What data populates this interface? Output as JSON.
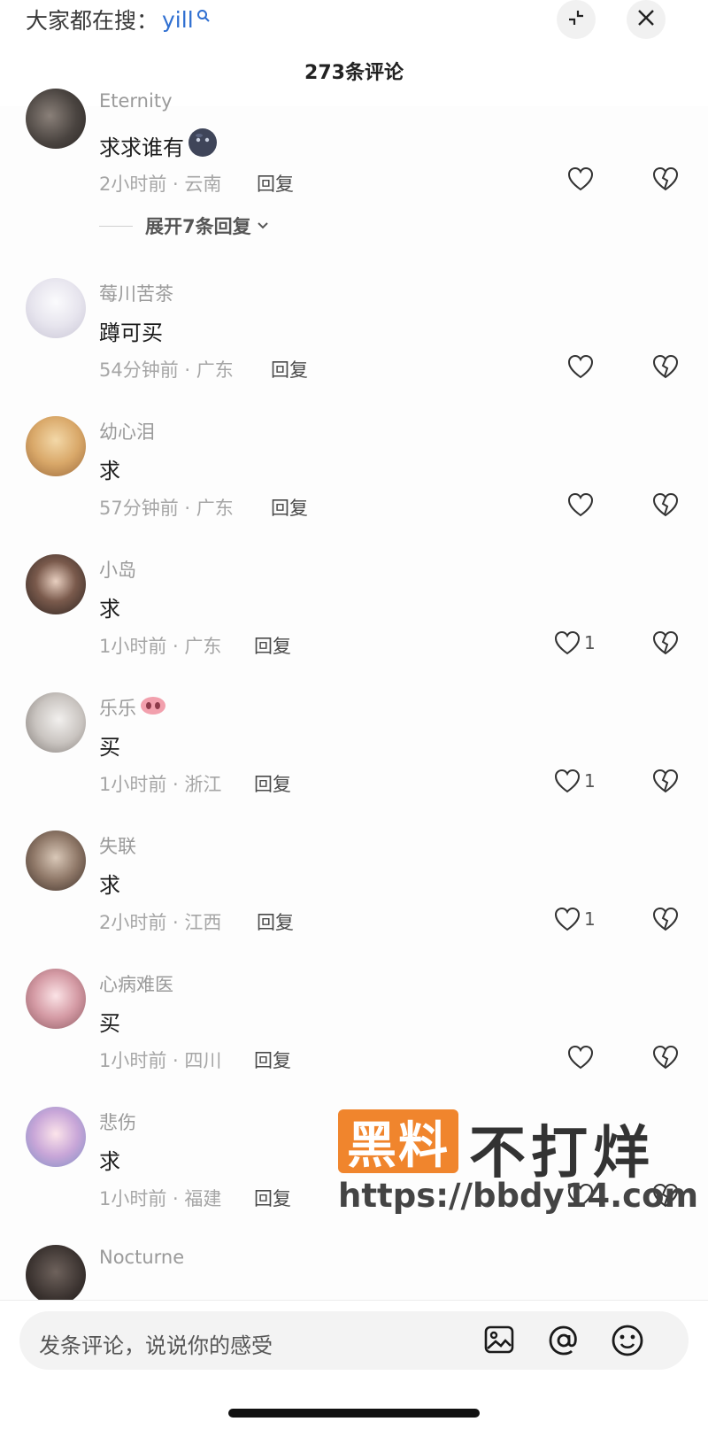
{
  "header": {
    "search_prefix": "大家都在搜：",
    "search_keyword": "yill",
    "comment_count": "273条评论"
  },
  "comments": [
    {
      "user": "Eternity",
      "text": "求求谁有",
      "emoji": "blob",
      "time_location": "2小时前 · 云南",
      "reply": "回复",
      "likes": "",
      "expand": "展开7条回复"
    },
    {
      "user": "莓川苦茶",
      "text": "蹲可买",
      "time_location": "54分钟前 · 广东",
      "reply": "回复",
      "likes": ""
    },
    {
      "user": "幼心泪",
      "text": "求",
      "time_location": "57分钟前 · 广东",
      "reply": "回复",
      "likes": ""
    },
    {
      "user": "小岛",
      "text": "求",
      "time_location": "1小时前 · 广东",
      "reply": "回复",
      "likes": "1"
    },
    {
      "user": "乐乐",
      "user_emoji": "pig-nose",
      "text": "买",
      "time_location": "1小时前 · 浙江",
      "reply": "回复",
      "likes": "1"
    },
    {
      "user": "失联",
      "text": "求",
      "time_location": "2小时前 · 江西",
      "reply": "回复",
      "likes": "1"
    },
    {
      "user": "心病难医",
      "text": "买",
      "time_location": "1小时前 · 四川",
      "reply": "回复",
      "likes": ""
    },
    {
      "user": "悲伤",
      "text": "求",
      "time_location": "1小时前 · 福建",
      "reply": "回复",
      "likes": ""
    },
    {
      "user": "Nocturne"
    }
  ],
  "watermark": {
    "box": "黑料",
    "title": "不打烊",
    "url": "https://bbdy14.com"
  },
  "bottom": {
    "placeholder": "发条评论，说说你的感受"
  },
  "colors": {
    "accent_link": "#2f6fd1",
    "watermark": "#f0852d"
  },
  "icons": [
    "search-icon",
    "collapse-icon",
    "close-icon",
    "heart-icon",
    "dislike-heart-icon",
    "image-icon",
    "at-icon",
    "emoji-icon",
    "chevron-down-icon"
  ]
}
